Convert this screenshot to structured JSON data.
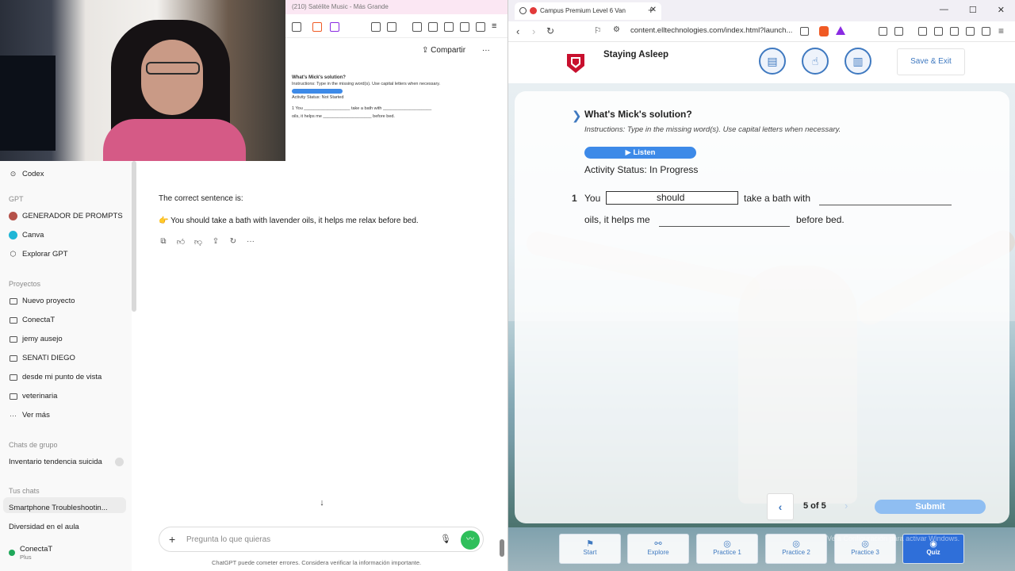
{
  "mini_browser": {
    "tab_title": "(210) Satélite Music - Más Grande",
    "share_label": "Compartir",
    "preview_title": "What's Mick's solution?",
    "preview_instructions": "Instructions: Type in the missing word(s). Use capital letters when necessary.",
    "preview_listen": "Listen",
    "preview_status": "Activity Status: Not Started",
    "preview_q1": "1   You ___________________ take a bath with ____________________",
    "preview_q2": "oils, it helps me ____________________ before bed."
  },
  "sidebar": {
    "codex": "Codex",
    "gpt_heading": "GPT",
    "gpts": [
      "GENERADOR DE PROMPTS",
      "Canva",
      "Explorar GPT"
    ],
    "projects_heading": "Proyectos",
    "projects": [
      "Nuevo proyecto",
      "ConectaT",
      "jemy ausejo",
      "SENATI DIEGO",
      "desde mi punto de vista",
      "veterinaria",
      "Ver más"
    ],
    "group_heading": "Chats de grupo",
    "group_chat": "Inventario tendencia suicida",
    "chats_heading": "Tus chats",
    "chats": [
      "Smartphone Troubleshootin...",
      "Diversidad en el aula"
    ],
    "account_name": "ConectaT",
    "account_plan": "Plus"
  },
  "chat": {
    "line1": "The correct sentence is:",
    "pointer_emoji": "👉",
    "line2": "You should take a bath with lavender oils, it helps me relax before bed.",
    "composer_placeholder": "Pregunta lo que quieras",
    "disclaimer": "ChatGPT puede cometer errores. Considera verificar la información importante."
  },
  "right_browser": {
    "tab_title": "Campus Premium Level 6 Van",
    "url": "content.elltechnologies.com/index.html?launch...",
    "lesson_title": "Staying Asleep",
    "save_exit": "Save & Exit"
  },
  "activity": {
    "title": "What's Mick's solution?",
    "instructions": "Instructions: Type in the missing word(s). Use capital letters when necessary.",
    "listen": "Listen",
    "status": "Activity Status: In Progress",
    "number": "1",
    "word_you": "You",
    "answer_value": "should",
    "mid_text": "take a bath with",
    "line2_start": "oils, it helps me",
    "line2_end": "before bed.",
    "page": "5 of 5",
    "submit": "Submit"
  },
  "bottom_nav": [
    "Start",
    "Explore",
    "Practice 1",
    "Practice 2",
    "Practice 3",
    "Quiz"
  ],
  "watermark": "Ve a Configuración para activar Windows.",
  "colors": {
    "accent": "#3f79c0",
    "listen": "#3d8ae8",
    "quiz_active": "#2f6fd9",
    "voice": "#2fbf5b"
  }
}
